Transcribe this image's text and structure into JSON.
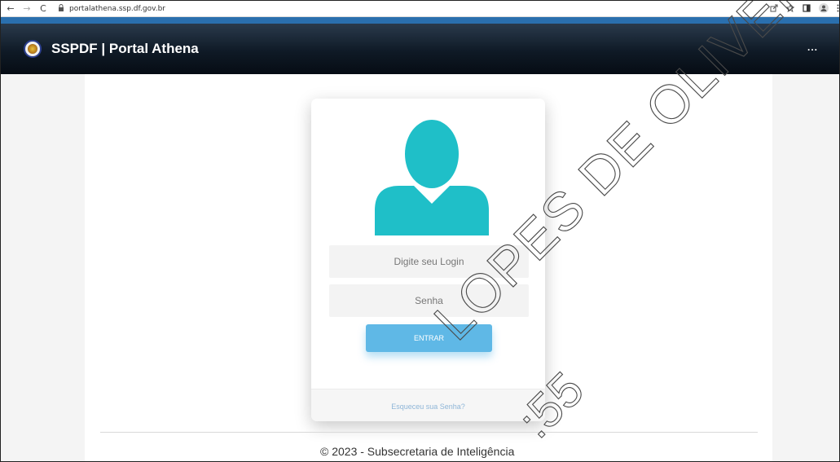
{
  "browser": {
    "back_icon": "←",
    "forward_icon": "→",
    "reload_icon": "C",
    "lock_icon": "🔒",
    "url": "portalathena.ssp.df.gov.br",
    "icons": [
      "share-icon",
      "star-icon",
      "sidepanel-icon",
      "profile-icon",
      "menu-icon"
    ]
  },
  "header": {
    "title": "SSPDF | Portal Athena",
    "more_label": "...",
    "accent_color": "#2a6fae"
  },
  "login": {
    "login_placeholder": "Digite seu Login",
    "password_placeholder": "Senha",
    "submit_label": "ENTRAR",
    "forgot_label": "Esqueceu sua Senha?",
    "avatar_color": "#1fbfc8",
    "button_color": "#5fb8e6"
  },
  "footer": {
    "copyright": "© 2023 - Subsecretaria de Inteligência"
  },
  "watermark": {
    "text": "LOPES DE OLIVEIRA",
    "text_small": ":55"
  }
}
